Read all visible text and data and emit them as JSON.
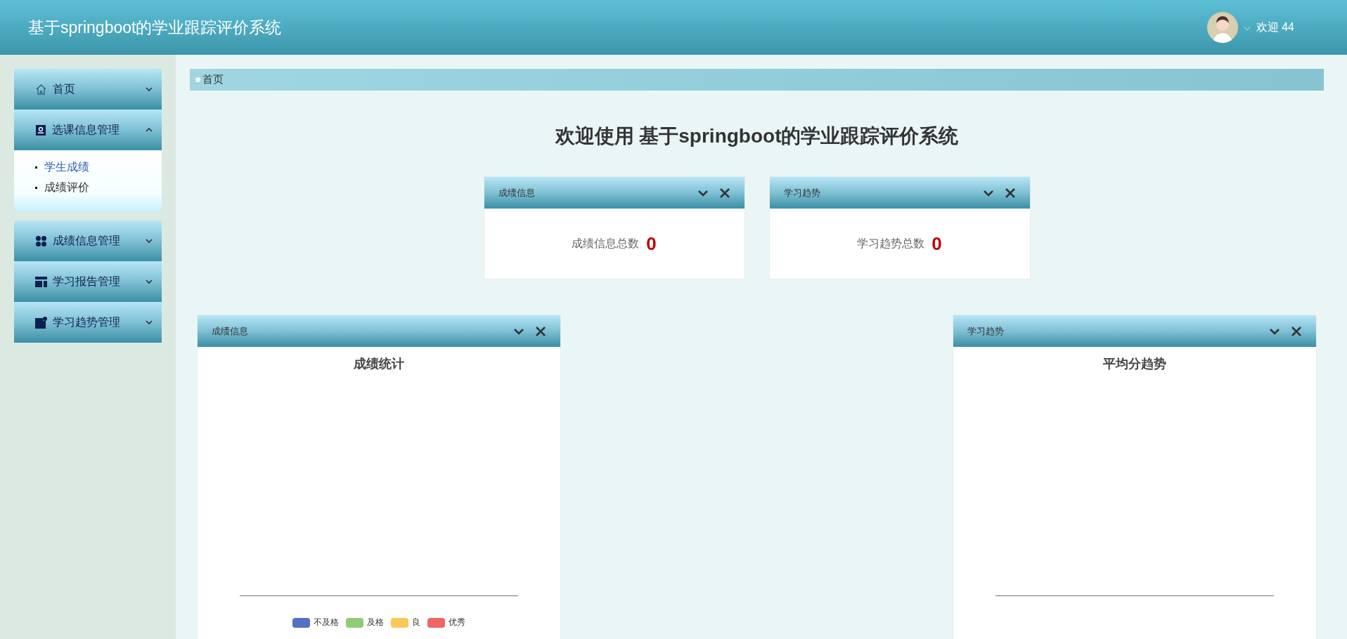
{
  "header": {
    "title": "基于springboot的学业跟踪评价系统",
    "user_caret": "⌵",
    "welcome": "欢迎 44"
  },
  "sidebar": {
    "items": [
      {
        "label": "首页",
        "expanded": false
      },
      {
        "label": "选课信息管理",
        "expanded": true,
        "children": [
          {
            "label": "学生成绩",
            "selected": true
          },
          {
            "label": "成绩评价",
            "selected": false
          }
        ]
      },
      {
        "label": "成绩信息管理",
        "expanded": false
      },
      {
        "label": "学习报告管理",
        "expanded": false
      },
      {
        "label": "学习趋势管理",
        "expanded": false
      }
    ]
  },
  "breadcrumb": "首页",
  "welcome_title": "欢迎使用 基于springboot的学业跟踪评价系统",
  "stat_cards": [
    {
      "title": "成绩信息",
      "label": "成绩信息总数",
      "count": "0"
    },
    {
      "title": "学习趋势",
      "label": "学习趋势总数",
      "count": "0"
    }
  ],
  "chart_panels": [
    {
      "title": "成绩信息",
      "chart_title": "成绩统计",
      "legend": [
        {
          "label": "不及格",
          "color": "#5470c6"
        },
        {
          "label": "及格",
          "color": "#91cc75"
        },
        {
          "label": "良",
          "color": "#fac858"
        },
        {
          "label": "优秀",
          "color": "#ee6666"
        }
      ]
    },
    {
      "title": "学习趋势",
      "chart_title": "平均分趋势"
    }
  ]
}
